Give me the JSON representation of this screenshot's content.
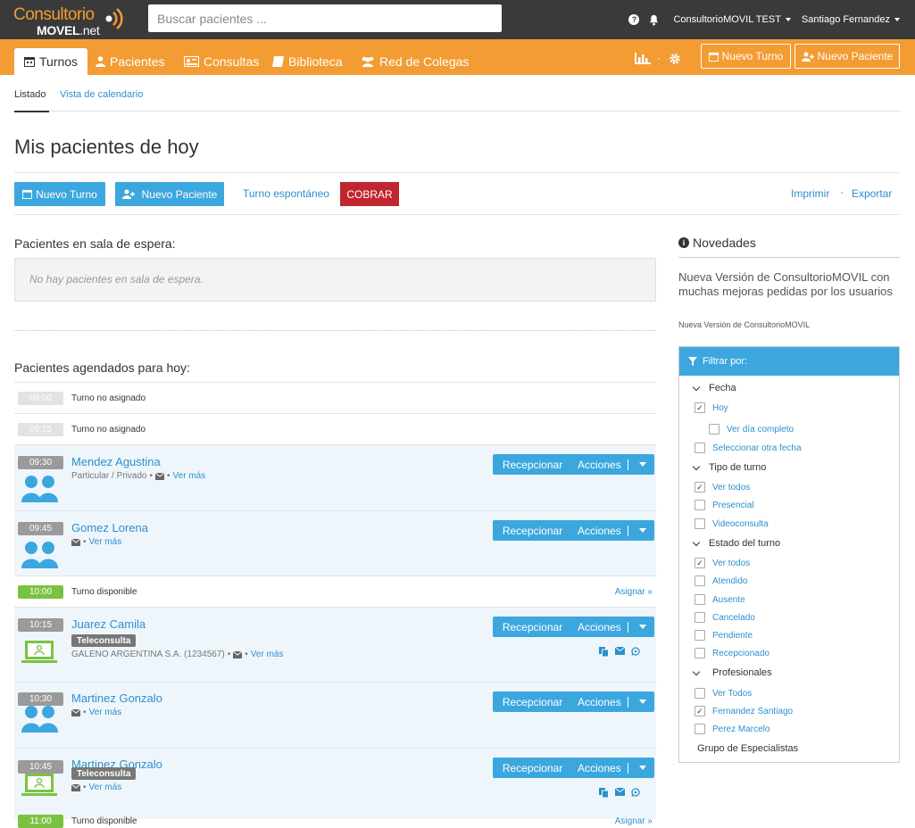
{
  "app": {
    "logo_line1": "Consultorio",
    "logo_line2a": "MOVEL",
    "logo_line2b": ".net"
  },
  "search": {
    "placeholder": "Buscar pacientes ..."
  },
  "topbar": {
    "account": "ConsultorioMOVIL TEST",
    "user": "Santiago Fernandez"
  },
  "nav": {
    "tabs": [
      {
        "label": "Turnos"
      },
      {
        "label": "Pacientes"
      },
      {
        "label": "Consultas"
      },
      {
        "label": "Biblioteca"
      },
      {
        "label": "Red de Colegas"
      }
    ],
    "dot": "·",
    "btn_nuevo_turno": "Nuevo Turno",
    "btn_nuevo_paciente": "Nuevo Paciente"
  },
  "subtabs": {
    "listado": "Listado",
    "calendario": "Vista de calendario"
  },
  "page": {
    "title": "Mis pacientes de hoy"
  },
  "actions": {
    "nuevo_turno": "Nuevo Turno",
    "nuevo_paciente": "Nuevo Paciente",
    "espontaneo": "Turno espontáneo",
    "cobrar": "COBRAR",
    "imprimir": "Imprimir",
    "sep": "·",
    "exportar": "Exportar"
  },
  "waiting": {
    "title": "Pacientes en sala de espera:",
    "empty": "No hay pacientes en sala de espera."
  },
  "scheduled": {
    "title": "Pacientes agendados para hoy:",
    "recepcionar": "Recepcionar",
    "acciones": "Acciones",
    "asignar": "Asignar »",
    "ver_mas": "Ver más",
    "bullet": "•",
    "rows": [
      {
        "time": "09:00",
        "text": "Turno no asignado"
      },
      {
        "time": "09:15",
        "text": "Turno no asignado"
      },
      {
        "time": "09:30",
        "name": "Mendez Agustina",
        "meta": "Particular / Privado"
      },
      {
        "time": "09:45",
        "name": "Gomez Lorena"
      },
      {
        "time": "10:00",
        "text": "Turno disponible"
      },
      {
        "time": "10:15",
        "name": "Juarez Camila",
        "badge": "Teleconsulta",
        "meta": "GALENO ARGENTINA S.A. (1234567)"
      },
      {
        "time": "10:30",
        "name": "Martinez Gonzalo"
      },
      {
        "time": "10:45",
        "name": "Martinez Gonzalo",
        "badge": "Teleconsulta"
      },
      {
        "time": "11:00",
        "text": "Turno disponible"
      }
    ]
  },
  "news": {
    "title": "Novedades",
    "body": "Nueva Versión de ConsultorioMOVIL con muchas mejoras pedidas por los usuarios",
    "sub": "Nueva Versión de ConsultorioMOVIL"
  },
  "filter": {
    "title": "Filtrar por:",
    "fecha": "Fecha",
    "hoy": "Hoy",
    "ver_dia": "Ver día completo",
    "otra_fecha": "Seleccionar otra fecha",
    "tipo": "Tipo de turno",
    "tipo_todos": "Ver todos",
    "presencial": "Presencial",
    "video": "Videoconsulta",
    "estado": "Estado del turno",
    "estado_todos": "Ver todos",
    "atendido": "Atendido",
    "ausente": "Ausente",
    "cancelado": "Cancelado",
    "pendiente": "Pendiente",
    "recepcionado": "Recepcionado",
    "profesionales": "Profesionales",
    "prof_todos": "Ver Todos",
    "fernandez": "Fernandez Santiago",
    "perez": "Perez Marcelo",
    "grupo": "Grupo de Especialistas",
    "check": "✓"
  },
  "colors": {
    "orange": "#f39c33",
    "blue": "#3ca7de",
    "red": "#c0262d",
    "green": "#7cc242",
    "dark": "#3a3a3a"
  }
}
